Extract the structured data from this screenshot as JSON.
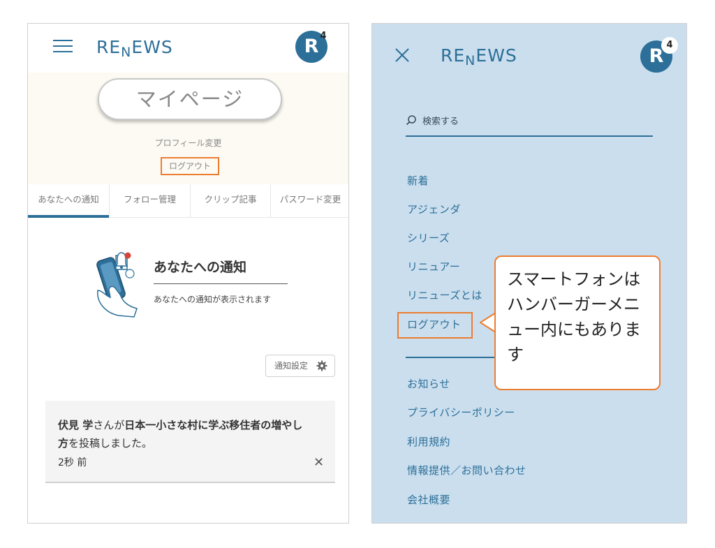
{
  "left_screen": {
    "header": {
      "logo": {
        "part1": "RE",
        "part2": "N",
        "part3": "E",
        "part4": "WS"
      },
      "avatar_letter": "R",
      "badge_count": "4"
    },
    "mypage": {
      "title": "マイページ",
      "profile_link": "プロフィール変更",
      "logout": "ログアウト"
    },
    "tabs": [
      {
        "label": "あなたへの通知",
        "active": true
      },
      {
        "label": "フォロー管理",
        "active": false
      },
      {
        "label": "クリップ記事",
        "active": false
      },
      {
        "label": "パスワード変更",
        "active": false
      }
    ],
    "notice": {
      "title": "あなたへの通知",
      "subtitle": "あなたへの通知が表示されます"
    },
    "settings_label": "通知設定",
    "post": {
      "user": "伏見 学",
      "text_a": "さんが",
      "article": "日本一小さな村に学ぶ移住者の増やし方",
      "text_b": "を投稿しました。",
      "time": "2秒 前",
      "close": "✕"
    }
  },
  "right_screen": {
    "header": {
      "logo": {
        "part1": "RE",
        "part2": "N",
        "part3": "E",
        "part4": "WS"
      },
      "avatar_letter": "R",
      "badge_count": "4"
    },
    "search_placeholder": "検索する",
    "menu_primary": [
      "新着",
      "アジェンダ",
      "シリーズ",
      "リニュアー",
      "リニューズとは",
      "ログアウト"
    ],
    "menu_secondary": [
      "お知らせ",
      "プライバシーポリシー",
      "利用規約",
      "情報提供／お問い合わせ",
      "会社概要"
    ]
  },
  "callout": {
    "text": "スマートフォンはハンバーガーメニュー内にもあります"
  },
  "colors": {
    "brand": "#2c6f98",
    "highlight": "#ed7d31",
    "menu_bg": "#cadeee",
    "mypage_bg": "#fcfaf3"
  }
}
